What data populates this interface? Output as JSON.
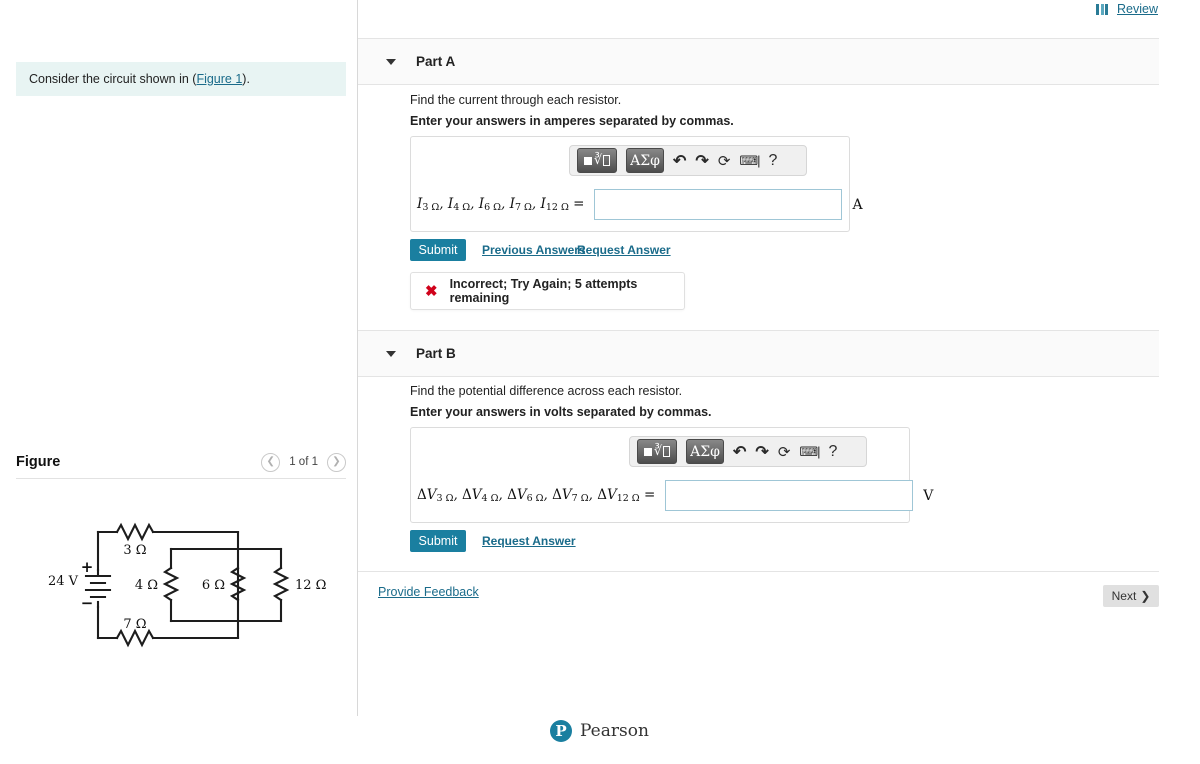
{
  "review": {
    "label": "Review",
    "icon": "book-icon",
    "color": "#1a6b8a"
  },
  "intro": {
    "text_before": "Consider the circuit shown in (",
    "link_label": "Figure 1",
    "text_after": ")."
  },
  "figure": {
    "title": "Figure",
    "counter": "1 of 1",
    "prev_icon": "chevron-left-icon",
    "next_icon": "chevron-right-icon",
    "circuit": {
      "source_label": "24 V",
      "plus_sign": "+",
      "minus_sign": "−",
      "resistors": [
        {
          "label": "3 Ω",
          "orientation": "horizontal",
          "position": "top"
        },
        {
          "label": "4 Ω",
          "orientation": "vertical",
          "position": "middle-left"
        },
        {
          "label": "6 Ω",
          "orientation": "vertical",
          "position": "middle-center"
        },
        {
          "label": "12 Ω",
          "orientation": "vertical",
          "position": "right"
        },
        {
          "label": "7 Ω",
          "orientation": "horizontal",
          "position": "bottom"
        }
      ]
    }
  },
  "parts": [
    {
      "id": "A",
      "header_label": "Part A",
      "caret_icon": "caret-down-icon",
      "prompt": "Find the current through each resistor.",
      "prompt_bold": "Enter your answers in amperes separated by commas.",
      "answer_label_html": "I<sub>3 Ω</sub>, I<sub>4 Ω</sub>, I<sub>6 Ω</sub>, I<sub>7 Ω</sub>, I<sub>12 Ω</sub> =",
      "answer_value": "",
      "answer_placeholder": "",
      "unit": "A",
      "submit_label": "Submit",
      "links": [
        "Previous Answers",
        "Request Answer"
      ],
      "feedback": {
        "icon": "error-x-icon",
        "message": "Incorrect; Try Again; 5 attempts remaining",
        "color": "#d0021b"
      }
    },
    {
      "id": "B",
      "header_label": "Part B",
      "caret_icon": "caret-down-icon",
      "prompt": "Find the potential difference across each resistor.",
      "prompt_bold": "Enter your answers in volts separated by commas.",
      "answer_label_html": "ΔV<sub>3 Ω</sub>, ΔV<sub>4 Ω</sub>, ΔV<sub>6 Ω</sub>, ΔV<sub>7 Ω</sub>, ΔV<sub>12 Ω</sub> =",
      "answer_value": "",
      "answer_placeholder": "",
      "unit": "V",
      "submit_label": "Submit",
      "links": [
        "Request Answer"
      ],
      "feedback": null
    }
  ],
  "mathbar": {
    "template_button": "template-tool",
    "greek_button": "ΑΣφ",
    "undo_icon": "⮪",
    "redo_icon": "⮫",
    "reset_icon": "⟳",
    "keyboard_icon": "⌨",
    "help_icon": "?"
  },
  "footer": {
    "provide_feedback": "Provide Feedback",
    "next_label": "Next",
    "next_icon": "chevron-right-icon",
    "brand": "Pearson",
    "brand_mark": "P",
    "brand_color": "#1a7fa0"
  }
}
